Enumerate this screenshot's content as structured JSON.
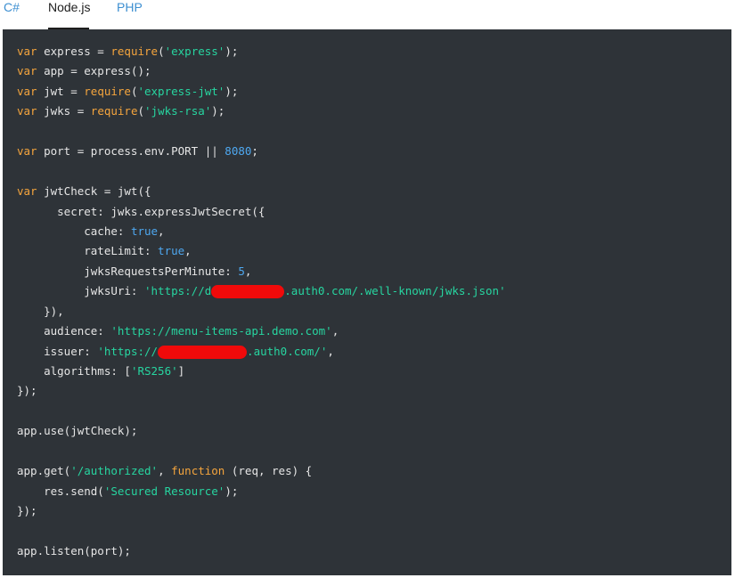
{
  "tabs": [
    {
      "label": "C#",
      "active": false
    },
    {
      "label": "Node.js",
      "active": true
    },
    {
      "label": "PHP",
      "active": false
    }
  ],
  "colors": {
    "panel_bg": "#2e3338",
    "keyword": "#f5a53d",
    "string": "#27d5a0",
    "number": "#4ea8f0",
    "tab_link": "#3d8fd1",
    "redaction": "#f00a0a"
  },
  "code": {
    "l1": {
      "kw": "var",
      "a": " express = ",
      "fn": "require",
      "b": "(",
      "s": "'express'",
      "c": ");"
    },
    "l2": {
      "kw": "var",
      "a": " app = express();"
    },
    "l3": {
      "kw": "var",
      "a": " jwt = ",
      "fn": "require",
      "b": "(",
      "s": "'express-jwt'",
      "c": ");"
    },
    "l4": {
      "kw": "var",
      "a": " jwks = ",
      "fn": "require",
      "b": "(",
      "s": "'jwks-rsa'",
      "c": ");"
    },
    "l6": {
      "kw": "var",
      "a": " port = process.env.PORT || ",
      "n": "8080",
      "c": ";"
    },
    "l8": {
      "kw": "var",
      "a": " jwtCheck = jwt({"
    },
    "l9": {
      "a": "      secret: jwks.expressJwtSecret({"
    },
    "l10": {
      "a": "          cache: ",
      "v": "true",
      "c": ","
    },
    "l11": {
      "a": "          rateLimit: ",
      "v": "true",
      "c": ","
    },
    "l12": {
      "a": "          jwksRequestsPerMinute: ",
      "n": "5",
      "c": ","
    },
    "l13": {
      "a": "          jwksUri: ",
      "s1": "'https://d",
      "s2": ".auth0.com/.well-known/jwks.json'"
    },
    "l14": {
      "a": "    }),"
    },
    "l15": {
      "a": "    audience: ",
      "s": "'https://menu-items-api.demo.com'",
      "c": ","
    },
    "l16": {
      "a": "    issuer: ",
      "s1": "'https://",
      "s2": ".auth0.com/'",
      "c": ","
    },
    "l17": {
      "a": "    algorithms: [",
      "s": "'RS256'",
      "c": "]"
    },
    "l18": {
      "a": "});"
    },
    "l20": {
      "a": "app.use(jwtCheck);"
    },
    "l22": {
      "a": "app.get(",
      "s": "'/authorized'",
      "b": ", ",
      "kw": "function",
      "c": " (req, res) {"
    },
    "l23": {
      "a": "    res.send(",
      "s": "'Secured Resource'",
      "c": ");"
    },
    "l24": {
      "a": "});"
    },
    "l26": {
      "a": "app.listen(port);"
    }
  }
}
